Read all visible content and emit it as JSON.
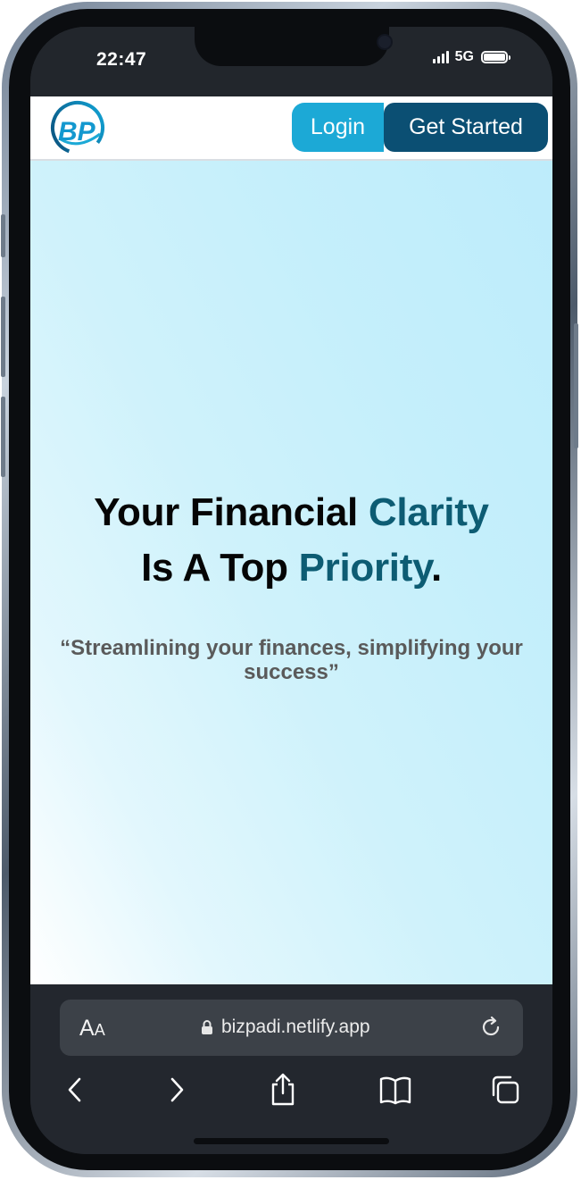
{
  "status_bar": {
    "time": "22:47",
    "network": "5G"
  },
  "site": {
    "logo_text": "BP",
    "login_label": "Login",
    "get_started_label": "Get Started"
  },
  "hero": {
    "headline_part1": "Your Financial ",
    "headline_accent1": "Clarity",
    "headline_part2": "Is A Top ",
    "headline_accent2": "Priority",
    "headline_end": ".",
    "tagline": "“Streamlining your finances, simplifying your success”"
  },
  "browser": {
    "text_size_label_big": "A",
    "text_size_label_small": "A",
    "url": "bizpadi.netlify.app"
  },
  "colors": {
    "accent_teal": "#0d5c73",
    "login_blue": "#1ca9d6",
    "get_started_navy": "#0b4f73"
  }
}
